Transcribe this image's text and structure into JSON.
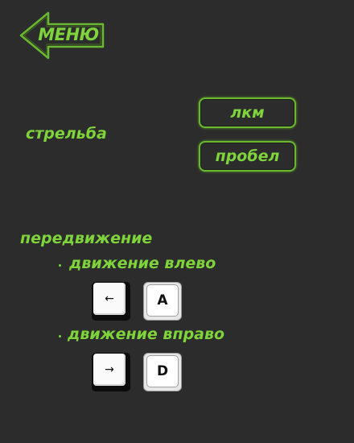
{
  "menu": {
    "label": "МЕНЮ",
    "icon": "back-arrow-icon"
  },
  "shooting": {
    "label": "стрельба",
    "bindings": [
      "лкм",
      "пробел"
    ]
  },
  "movement": {
    "label": "передвижение",
    "left": {
      "label": "движение влево",
      "keys": [
        "←",
        "A"
      ]
    },
    "right": {
      "label": "движение вправо",
      "keys": [
        "→",
        "D"
      ]
    }
  },
  "colors": {
    "background": "#2c2c2c",
    "accent_green": "#7ed43a",
    "button_border": "#6ab82e"
  }
}
